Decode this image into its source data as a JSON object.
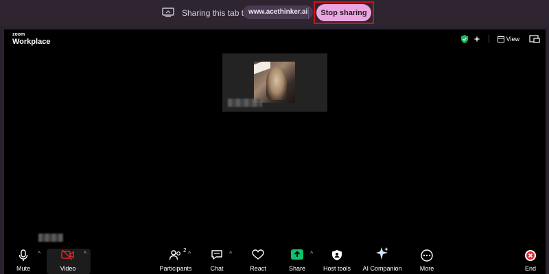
{
  "share_banner": {
    "message": "Sharing this tab to",
    "domain": "www.acethinker.ai",
    "stop_button": "Stop sharing"
  },
  "zoom": {
    "brand_small": "zoom",
    "brand_large": "Workplace",
    "view_label": "View"
  },
  "toolbar": {
    "mute": "Mute",
    "video": "Video",
    "participants": "Participants",
    "participants_count": "2",
    "chat": "Chat",
    "react": "React",
    "share": "Share",
    "host_tools": "Host tools",
    "ai_companion": "AI Companion",
    "more": "More",
    "end": "End"
  },
  "colors": {
    "stop_button_bg": "#e9a6e0",
    "highlight_outline": "#d0121b",
    "share_green": "#0ec26d",
    "end_red": "#e02828"
  },
  "icons": [
    "monitor-icon",
    "shield-check-icon",
    "sparkle-icon",
    "view-grid-icon",
    "pip-icon",
    "microphone-icon",
    "video-off-icon",
    "participants-icon",
    "chat-icon",
    "heart-icon",
    "share-arrow-icon",
    "host-shield-icon",
    "ai-sparkle-icon",
    "more-icon",
    "end-x-icon"
  ]
}
